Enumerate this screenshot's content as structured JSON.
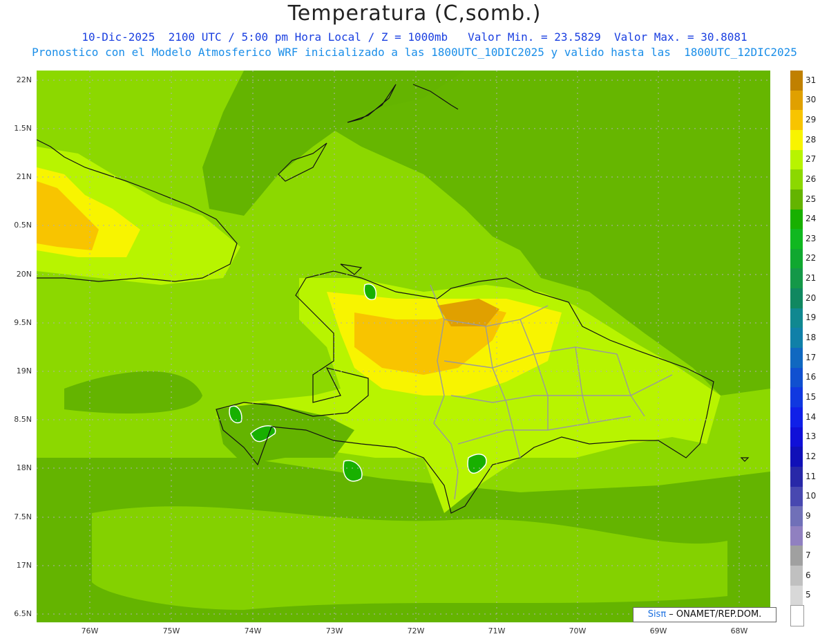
{
  "header": {
    "title": "Temperatura (C,somb.)",
    "line2": "10-Dic-2025  2100 UTC / 5:00 pm Hora Local / Z = 1000mb   Valor Min. = 23.5829  Valor Max. = 30.8081",
    "line3": "Pronostico con el Modelo Atmosferico WRF inicializado a las 1800UTC_10DIC2025 y valido hasta las  1800UTC_12DIC2025"
  },
  "axes": {
    "lat_labels": [
      "22N",
      "1.5N",
      "21N",
      "0.5N",
      "20N",
      "9.5N",
      "19N",
      "8.5N",
      "18N",
      "7.5N",
      "17N",
      "6.5N"
    ],
    "lon_labels": [
      "76W",
      "75W",
      "74W",
      "73W",
      "72W",
      "71W",
      "70W",
      "69W",
      "68W"
    ]
  },
  "colorbar": {
    "labels": [
      "31",
      "30",
      "29",
      "28",
      "27",
      "26",
      "25",
      "24",
      "23",
      "22",
      "21",
      "20",
      "19",
      "18",
      "17",
      "16",
      "15",
      "14",
      "13",
      "12",
      "11",
      "10",
      "9",
      "8",
      "7",
      "6",
      "5"
    ],
    "colors": [
      "#c08000",
      "#e0a000",
      "#f8c400",
      "#f8f400",
      "#b8f400",
      "#8cd800",
      "#64b400",
      "#18b000",
      "#10b820",
      "#10a830",
      "#149848",
      "#108860",
      "#108890",
      "#1080a8",
      "#1068c0",
      "#1050d0",
      "#1038e0",
      "#1020e8",
      "#1010d8",
      "#1010b8",
      "#2828a8",
      "#4848b0",
      "#7070b8",
      "#9080c0",
      "#a0a0a0",
      "#c0c0c0",
      "#d8d8d8",
      "#ffffff"
    ]
  },
  "credit": {
    "sis": "Sisπ",
    "text": " – ONAMET/REP.DOM."
  }
}
